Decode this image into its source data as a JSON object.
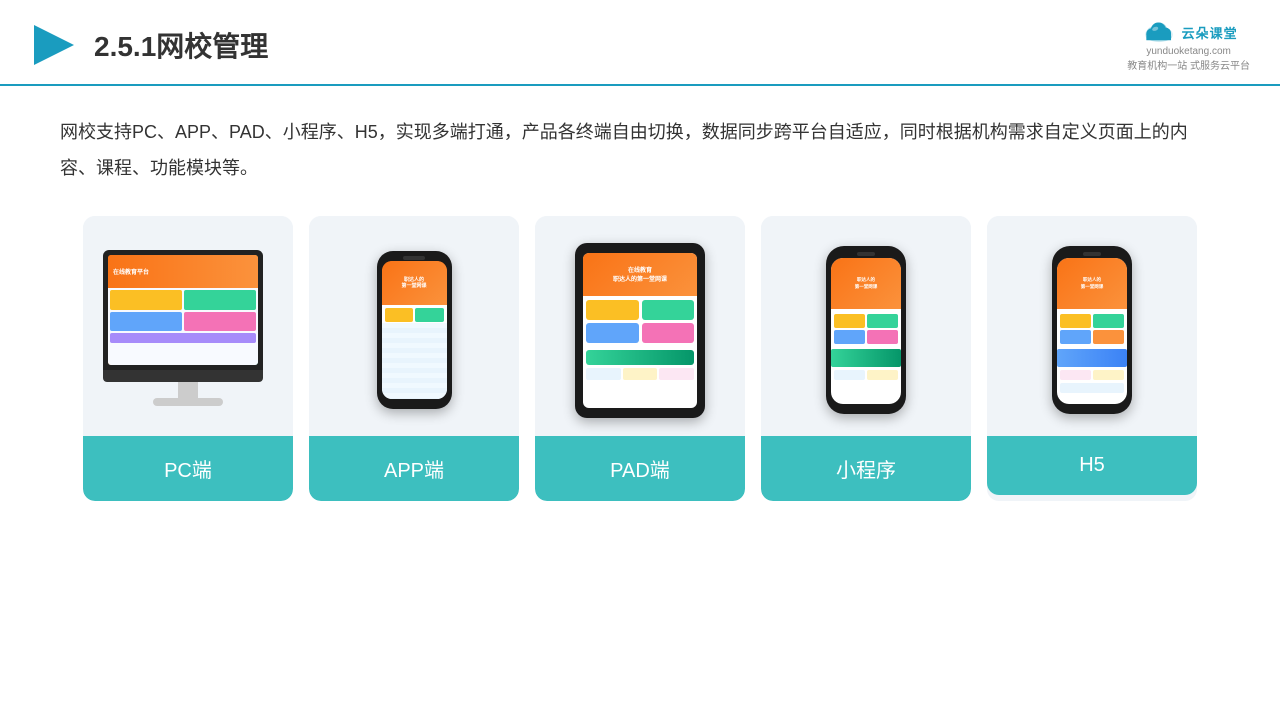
{
  "header": {
    "title": "2.5.1网校管理",
    "logo_main": "云朵课堂",
    "logo_url_text": "yunduoketang.com",
    "logo_sub_line1": "教育机构一站",
    "logo_sub_line2": "式服务云平台"
  },
  "description": {
    "text": "网校支持PC、APP、PAD、小程序、H5，实现多端打通，产品各终端自由切换，数据同步跨平台自适应，同时根据机构需求自定义页面上的内容、课程、功能模块等。"
  },
  "cards": [
    {
      "id": "pc",
      "label": "PC端"
    },
    {
      "id": "app",
      "label": "APP端"
    },
    {
      "id": "pad",
      "label": "PAD端"
    },
    {
      "id": "miniapp",
      "label": "小程序"
    },
    {
      "id": "h5",
      "label": "H5"
    }
  ],
  "accent_color": "#3dbfbf",
  "header_line_color": "#1a9cbf"
}
